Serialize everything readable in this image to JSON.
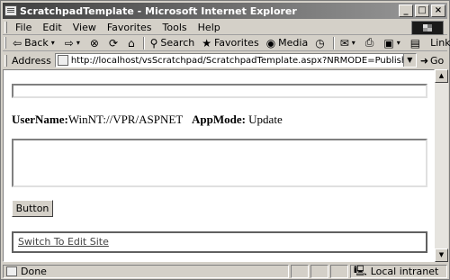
{
  "window": {
    "title": "ScratchpadTemplate - Microsoft Internet Explorer",
    "controls": {
      "minimize": "_",
      "maximize": "□",
      "close": "×"
    }
  },
  "menu": [
    "File",
    "Edit",
    "View",
    "Favorites",
    "Tools",
    "Help"
  ],
  "toolbar": {
    "back": "Back",
    "search": "Search",
    "favorites": "Favorites",
    "media": "Media",
    "links": "Links"
  },
  "address": {
    "label": "Address",
    "url": "http://localhost/vsScratchpad/ScratchpadTemplate.aspx?NRMODE=Published&NRORIGINALURL=%2fS",
    "go": "Go"
  },
  "page": {
    "username_label": "UserName:",
    "username_value": "WinNT://VPR/ASPNET",
    "appmode_label": "AppMode:",
    "appmode_value": "Update",
    "button_label": "Button",
    "link_text": "Switch To Edit Site"
  },
  "status": {
    "text": "Done",
    "zone": "Local intranet"
  }
}
